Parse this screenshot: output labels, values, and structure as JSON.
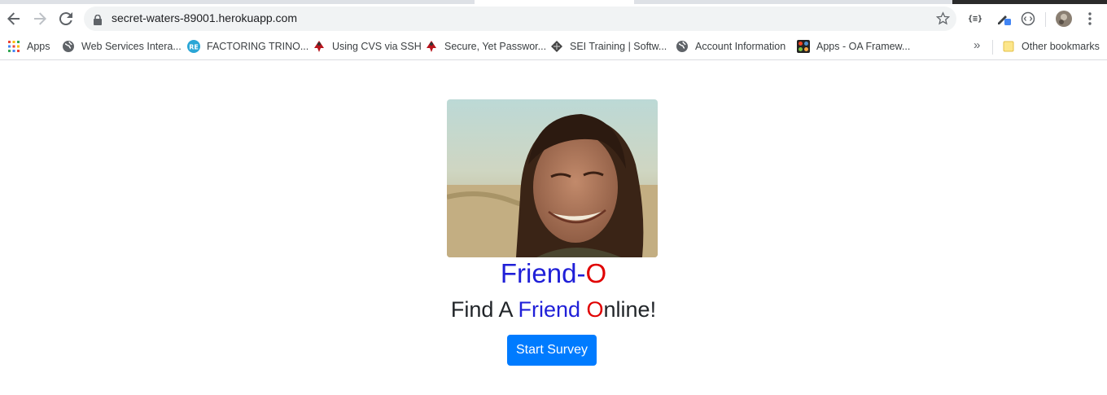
{
  "browser": {
    "url": "secret-waters-89001.herokuapp.com",
    "bookmarks": [
      {
        "label": "Apps",
        "icon": "apps-grid-icon"
      },
      {
        "label": "Web Services Intera...",
        "icon": "globe-icon"
      },
      {
        "label": "FACTORING TRINO...",
        "icon": "re-site-icon"
      },
      {
        "label": "Using CVS via SSH",
        "icon": "bug-icon"
      },
      {
        "label": "Secure, Yet Passwor...",
        "icon": "bug-icon"
      },
      {
        "label": "SEI Training | Softw...",
        "icon": "sei-icon"
      },
      {
        "label": "Account Information",
        "icon": "globe-icon"
      },
      {
        "label": "Apps - OA Framew...",
        "icon": "joomla-icon"
      }
    ],
    "more_label": "»",
    "other_bookmarks": {
      "label": "Other bookmarks",
      "icon": "folder-icon"
    }
  },
  "page": {
    "brand": {
      "part1": "Friend",
      "dash": "-",
      "part2": "O"
    },
    "tagline": {
      "prefix": "Find A ",
      "friend": "Friend",
      "space": " ",
      "o": "O",
      "rest": "nline!"
    },
    "start_button": "Start Survey",
    "colors": {
      "blue": "#2020d8",
      "red": "#e00000",
      "button": "#007bff"
    }
  }
}
